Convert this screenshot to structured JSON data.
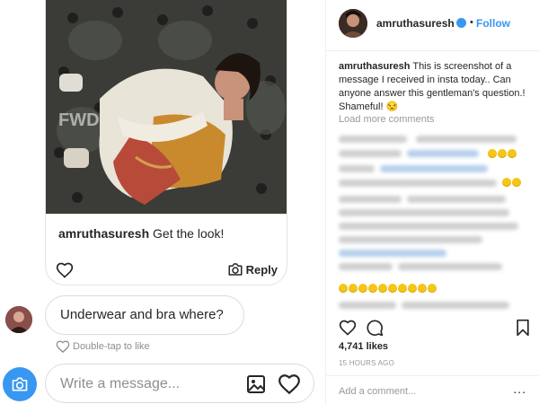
{
  "thread": {
    "shared_post": {
      "watermark": "FWD",
      "caption_user": "amruthasuresh",
      "caption_text": "Get the look!",
      "reply_label": "Reply",
      "icons": {
        "like": "heart-outline-icon",
        "reply": "camera-icon"
      }
    },
    "message": {
      "text": "Underwear and bra where?"
    },
    "double_tap_label": "Double-tap to like",
    "composer": {
      "placeholder": "Write a message...",
      "icons": {
        "camera": "camera-icon",
        "image": "image-icon",
        "like": "heart-outline-icon"
      }
    }
  },
  "post": {
    "username": "amruthasuresh",
    "separator": "•",
    "follow_label": "Follow",
    "caption_user": "amruthasuresh",
    "caption_text": "This is screenshot of a message I received in insta today.. Can anyone answer this gentleman's question.! Shameful! 😒",
    "load_more_label": "Load more comments",
    "likes": "4,741 likes",
    "timestamp": "15 HOURS AGO",
    "add_comment_placeholder": "Add a comment...",
    "more_label": "...",
    "icons": {
      "like": "heart-outline-icon",
      "comment": "comment-icon",
      "save": "bookmark-icon",
      "verified": "verified-badge-icon"
    }
  },
  "colors": {
    "accent": "#3897f0",
    "text": "#262626",
    "muted": "#8e8e8e",
    "border": "#dbdbdb"
  }
}
